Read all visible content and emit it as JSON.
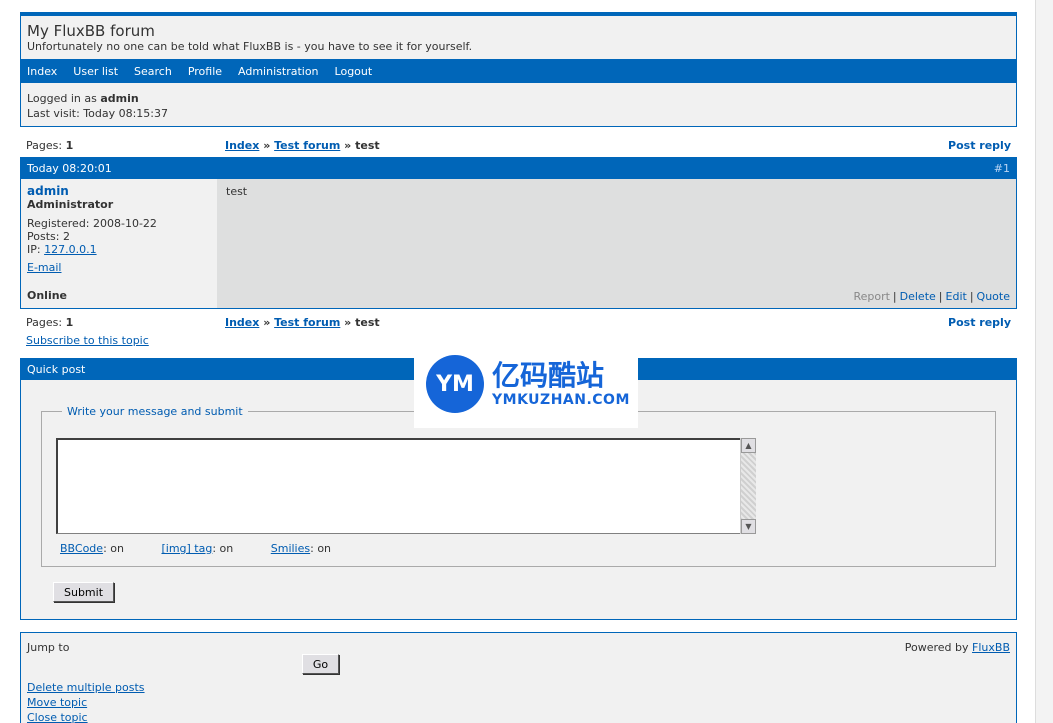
{
  "header": {
    "title": "My FluxBB forum",
    "description": "Unfortunately no one can be told what FluxBB is - you have to see it for yourself."
  },
  "menu": [
    "Index",
    "User list",
    "Search",
    "Profile",
    "Administration",
    "Logout"
  ],
  "welcome": {
    "logged_in_prefix": "Logged in as ",
    "username": "admin",
    "last_visit": "Last visit: Today 08:15:37"
  },
  "linkrow": {
    "pages_label": "Pages: ",
    "pages_value": "1",
    "crumb_index": "Index",
    "crumb_sep": " » ",
    "crumb_forum": "Test forum",
    "crumb_topic": "test",
    "post_reply": "Post reply"
  },
  "post": {
    "time": "Today 08:20:01",
    "number": "#1",
    "author": "admin",
    "user_title": "Administrator",
    "registered": "Registered: 2008-10-22",
    "posts": "Posts: 2",
    "ip_label": "IP: ",
    "ip": "127.0.0.1",
    "email": "E-mail",
    "status": "Online",
    "message": "test",
    "actions": {
      "report": "Report",
      "delete": "Delete",
      "edit": "Edit",
      "quote": "Quote",
      "sep": "|"
    }
  },
  "subscribe": "Subscribe to this topic",
  "quickpost": {
    "heading": "Quick post",
    "legend": "Write your message and submit",
    "message_value": "",
    "bbcode_label": "BBCode",
    "img_label": "[img] tag",
    "smilies_label": "Smilies",
    "status_suffix": ": on",
    "submit": "Submit"
  },
  "footer": {
    "jump_to": "Jump to",
    "go": "Go",
    "powered_prefix": "Powered by ",
    "powered_link": "FluxBB",
    "mod_links": [
      "Delete multiple posts",
      "Move topic",
      "Close topic"
    ]
  },
  "watermark": {
    "cn": "亿码酷站",
    "en": "YMKUZHAN.COM",
    "logo": "YM"
  },
  "colors": {
    "accent": "#0066B9",
    "link": "#005CB1",
    "panel": "#f1f1f1",
    "post_body": "#dedfdf"
  }
}
